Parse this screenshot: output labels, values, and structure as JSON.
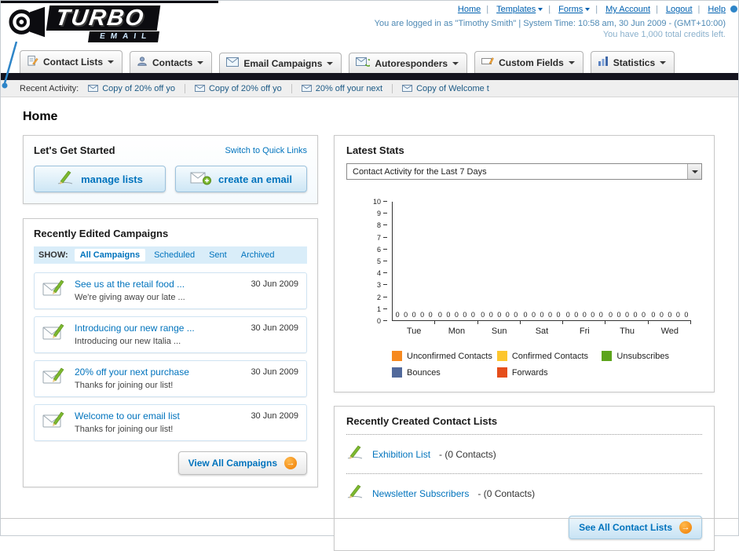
{
  "header": {
    "logo_title": "TURBO",
    "logo_subtitle": "EMAIL",
    "nav": [
      {
        "label": "Home"
      },
      {
        "label": "Templates"
      },
      {
        "label": "Forms"
      },
      {
        "label": "My Account"
      },
      {
        "label": "Logout"
      },
      {
        "label": "Help"
      }
    ],
    "login_info": "You are logged in as \"Timothy Smith\" | System Time: 10:58 am, 30 Jun 2009 - (GMT+10:00)",
    "credits_info": "You have 1,000 total credits left."
  },
  "main_nav": {
    "items": [
      {
        "label": "Contact Lists"
      },
      {
        "label": "Contacts"
      },
      {
        "label": "Email Campaigns"
      },
      {
        "label": "Autoresponders"
      },
      {
        "label": "Custom Fields"
      },
      {
        "label": "Statistics"
      }
    ]
  },
  "activity": {
    "label": "Recent Activity:",
    "items": [
      "Copy of 20% off yo",
      "Copy of 20% off yo",
      "20% off your next",
      "Copy of Welcome t"
    ]
  },
  "page": {
    "title": "Home"
  },
  "get_started": {
    "title": "Let's Get Started",
    "switch_link": "Switch to Quick Links",
    "manage_lists_label": "manage lists",
    "create_email_label": "create an email"
  },
  "campaigns": {
    "title": "Recently Edited Campaigns",
    "show_label": "SHOW:",
    "tabs": [
      {
        "label": "All Campaigns",
        "active": true
      },
      {
        "label": "Scheduled",
        "active": false
      },
      {
        "label": "Sent",
        "active": false
      },
      {
        "label": "Archived",
        "active": false
      }
    ],
    "items": [
      {
        "title": "See us at the retail food ...",
        "subtitle": "We're giving away our late ...",
        "date": "30 Jun 2009"
      },
      {
        "title": "Introducing our new range ...",
        "subtitle": "Introducing our new Italia ...",
        "date": "30 Jun 2009"
      },
      {
        "title": "20% off your next purchase",
        "subtitle": "Thanks for joining our list!",
        "date": "30 Jun 2009"
      },
      {
        "title": "Welcome to our email list",
        "subtitle": "Thanks for joining our list!",
        "date": "30 Jun 2009"
      }
    ],
    "view_all_label": "View All Campaigns"
  },
  "stats": {
    "title": "Latest Stats",
    "filter_value": "Contact Activity for the Last 7 Days",
    "chart_data": {
      "type": "bar",
      "title": "Contact Activity for the Last 7 Days",
      "categories": [
        "Tue",
        "Mon",
        "Sun",
        "Sat",
        "Fri",
        "Thu",
        "Wed"
      ],
      "series": [
        {
          "name": "Unconfirmed Contacts",
          "color": "#f6891f",
          "values": [
            0,
            0,
            0,
            0,
            0,
            0,
            0
          ]
        },
        {
          "name": "Confirmed Contacts",
          "color": "#fdc62e",
          "values": [
            0,
            0,
            0,
            0,
            0,
            0,
            0
          ]
        },
        {
          "name": "Unsubscribes",
          "color": "#5ca41c",
          "values": [
            0,
            0,
            0,
            0,
            0,
            0,
            0
          ]
        },
        {
          "name": "Bounces",
          "color": "#51699b",
          "values": [
            0,
            0,
            0,
            0,
            0,
            0,
            0
          ]
        },
        {
          "name": "Forwards",
          "color": "#e54e1b",
          "values": [
            0,
            0,
            0,
            0,
            0,
            0,
            0
          ]
        }
      ],
      "ylim": [
        0,
        10
      ],
      "grid": false,
      "legend_position": "bottom",
      "value_labels": true
    }
  },
  "contact_lists": {
    "title": "Recently Created Contact Lists",
    "items": [
      {
        "name": "Exhibition List",
        "detail": "- (0 Contacts)"
      },
      {
        "name": "Newsletter Subscribers",
        "detail": "- (0 Contacts)"
      }
    ],
    "see_all_label": "See All Contact Lists"
  }
}
